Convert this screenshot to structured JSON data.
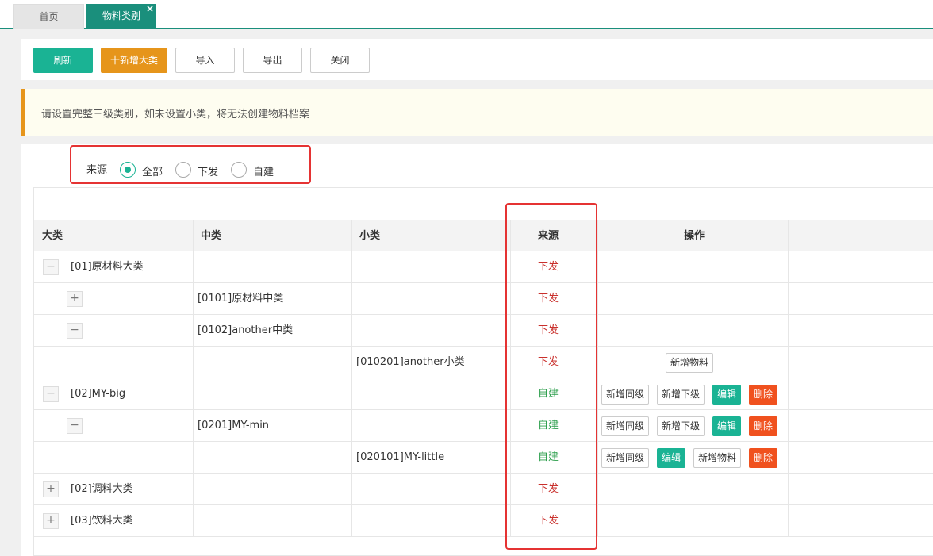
{
  "tabs": [
    {
      "label": "首页"
    },
    {
      "label": "物料类别",
      "close": "×"
    }
  ],
  "toolbar": {
    "refresh": "刷新",
    "add_major": "十新增大类",
    "import": "导入",
    "export": "导出",
    "close": "关闭"
  },
  "notice": "请设置完整三级类别，如未设置小类，将无法创建物料档案",
  "filter": {
    "label": "来源",
    "options": [
      {
        "label": "全部",
        "checked": true
      },
      {
        "label": "下发",
        "checked": false
      },
      {
        "label": "自建",
        "checked": false
      }
    ]
  },
  "table": {
    "headers": {
      "major": "大类",
      "middle": "中类",
      "minor": "小类",
      "source": "来源",
      "actions": "操作"
    },
    "rows": [
      {
        "toggle": "−",
        "major": "[01]原材料大类",
        "middle": "",
        "minor": "",
        "source": "下发"
      },
      {
        "toggle": "+",
        "major": "",
        "middle": "[0101]原材料中类",
        "minor": "",
        "source": "下发"
      },
      {
        "toggle": "−",
        "major": "",
        "middle": "[0102]another中类",
        "minor": "",
        "source": "下发"
      },
      {
        "toggle": "",
        "major": "",
        "middle": "",
        "minor": "[010201]another小类",
        "source": "下发",
        "actions": [
          "新增物料"
        ]
      },
      {
        "toggle": "−",
        "major": "[02]MY-big",
        "middle": "",
        "minor": "",
        "source": "自建",
        "actions": [
          "新增同级",
          "新增下级",
          "编辑",
          "删除"
        ]
      },
      {
        "toggle": "−",
        "major": "",
        "middle": "[0201]MY-min",
        "minor": "",
        "source": "自建",
        "actions": [
          "新增同级",
          "新增下级",
          "编辑",
          "删除"
        ]
      },
      {
        "toggle": "",
        "major": "",
        "middle": "",
        "minor": "[020101]MY-little",
        "source": "自建",
        "actions": [
          "新增同级",
          "编辑",
          "新增物料",
          "删除"
        ]
      },
      {
        "toggle": "+",
        "major": "[02]调料大类",
        "middle": "",
        "minor": "",
        "source": "下发"
      },
      {
        "toggle": "+",
        "major": "[03]饮料大类",
        "middle": "",
        "minor": "",
        "source": "下发"
      }
    ]
  },
  "colors": {
    "accent": "#1ab394",
    "orange": "#e6951b",
    "danger": "#f0511e",
    "highlight": "#e53333"
  }
}
